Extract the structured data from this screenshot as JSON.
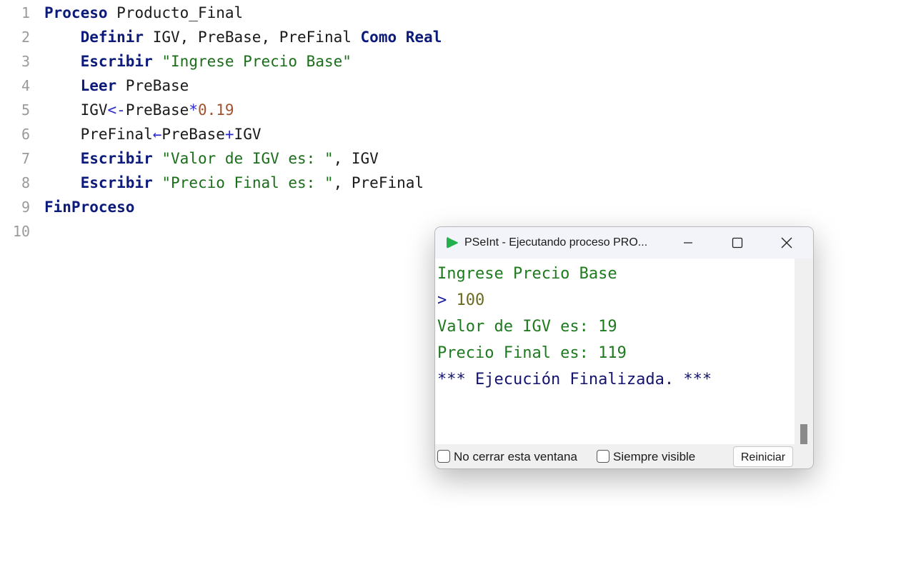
{
  "editor": {
    "line_numbers": [
      "1",
      "2",
      "3",
      "4",
      "5",
      "6",
      "7",
      "8",
      "9",
      "10"
    ],
    "lines": [
      [
        {
          "t": "Proceso",
          "c": "kw"
        },
        {
          "t": " Producto_Final",
          "c": "id"
        }
      ],
      [
        {
          "t": "    ",
          "c": "id"
        },
        {
          "t": "Definir",
          "c": "kw"
        },
        {
          "t": " IGV, PreBase, PreFinal ",
          "c": "id"
        },
        {
          "t": "Como",
          "c": "kw"
        },
        {
          "t": " ",
          "c": "id"
        },
        {
          "t": "Real",
          "c": "kw"
        }
      ],
      [
        {
          "t": "    ",
          "c": "id"
        },
        {
          "t": "Escribir",
          "c": "kw"
        },
        {
          "t": " ",
          "c": "id"
        },
        {
          "t": "\"Ingrese Precio Base\"",
          "c": "str"
        }
      ],
      [
        {
          "t": "    ",
          "c": "id"
        },
        {
          "t": "Leer",
          "c": "kw"
        },
        {
          "t": " PreBase",
          "c": "id"
        }
      ],
      [
        {
          "t": "    IGV",
          "c": "id"
        },
        {
          "t": "<-",
          "c": "op"
        },
        {
          "t": "PreBase",
          "c": "id"
        },
        {
          "t": "*",
          "c": "op"
        },
        {
          "t": "0.19",
          "c": "num"
        }
      ],
      [
        {
          "t": "    PreFinal",
          "c": "id"
        },
        {
          "t": "←",
          "c": "op"
        },
        {
          "t": "PreBase",
          "c": "id"
        },
        {
          "t": "+",
          "c": "op"
        },
        {
          "t": "IGV",
          "c": "id"
        }
      ],
      [
        {
          "t": "    ",
          "c": "id"
        },
        {
          "t": "Escribir",
          "c": "kw"
        },
        {
          "t": " ",
          "c": "id"
        },
        {
          "t": "\"Valor de IGV es: \"",
          "c": "str"
        },
        {
          "t": ", IGV",
          "c": "id"
        }
      ],
      [
        {
          "t": "    ",
          "c": "id"
        },
        {
          "t": "Escribir",
          "c": "kw"
        },
        {
          "t": " ",
          "c": "id"
        },
        {
          "t": "\"Precio Final es: \"",
          "c": "str"
        },
        {
          "t": ", PreFinal",
          "c": "id"
        }
      ],
      [
        {
          "t": "FinProceso",
          "c": "kw"
        }
      ],
      []
    ]
  },
  "window": {
    "title": "PSeInt - Ejecutando proceso PRO...",
    "icons": {
      "app": "pseint-play-icon",
      "minimize": "minimize-icon",
      "maximize": "maximize-icon",
      "close": "close-icon"
    },
    "console": {
      "line1": "Ingrese Precio Base",
      "prompt_symbol": ">",
      "input_value": "100",
      "line3": "Valor de IGV es: 19",
      "line4": "Precio Final es: 119",
      "line5": "*** Ejecución Finalizada. ***"
    },
    "options": {
      "no_cerrar": "No cerrar esta ventana",
      "siempre_visible": "Siempre visible",
      "reiniciar": "Reiniciar"
    }
  },
  "colors": {
    "keyword": "#0c1a7a",
    "string": "#1a6e1a",
    "number": "#a0522d",
    "operator": "#2a2ad0",
    "app_icon": "#22b14c"
  }
}
